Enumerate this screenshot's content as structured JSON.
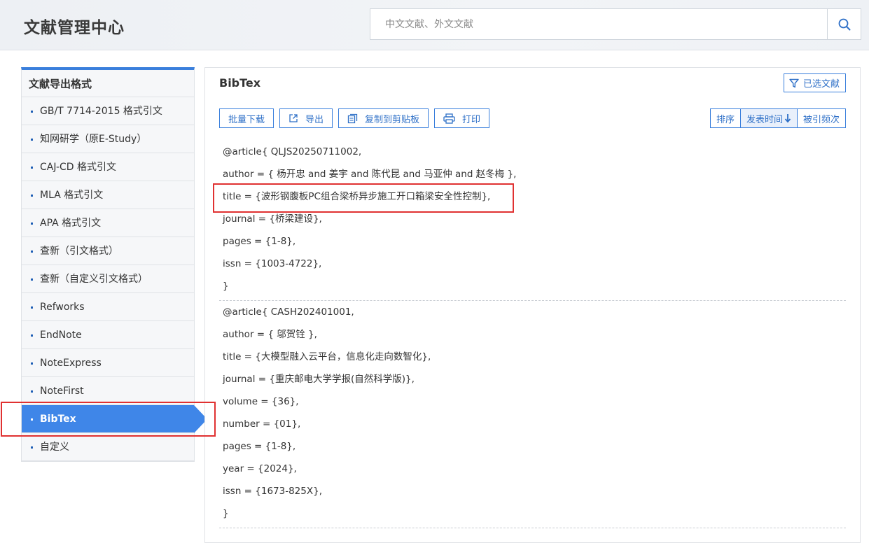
{
  "header": {
    "brand": "文献管理中心",
    "search_placeholder": "中文文献、外文文献"
  },
  "sidebar": {
    "title": "文献导出格式",
    "items": [
      {
        "label": "GB/T 7714-2015 格式引文"
      },
      {
        "label": "知网研学（原E-Study）"
      },
      {
        "label": "CAJ-CD 格式引文"
      },
      {
        "label": "MLA 格式引文"
      },
      {
        "label": "APA 格式引文"
      },
      {
        "label": "查新（引文格式）"
      },
      {
        "label": "查新（自定义引文格式）"
      },
      {
        "label": "Refworks"
      },
      {
        "label": "EndNote"
      },
      {
        "label": "NoteExpress"
      },
      {
        "label": "NoteFirst"
      },
      {
        "label": "BibTex",
        "active": true
      },
      {
        "label": "自定义"
      }
    ]
  },
  "main": {
    "title": "BibTex",
    "selected_label": "已选文献",
    "toolbar": {
      "batch_download": "批量下载",
      "export": "导出",
      "copy": "复制到剪贴板",
      "print": "打印"
    },
    "sort": {
      "label": "排序",
      "pub_time": "发表时间",
      "cited": "被引频次"
    },
    "entries": [
      {
        "lines": [
          "@article{ QLJS20250711002,",
          "author = { 杨开忠 and  姜宇 and  陈代昆 and  马亚仲 and  赵冬梅 },",
          "title = {波形钢腹板PC组合梁桥异步施工开口箱梁安全性控制},",
          "journal = {桥梁建设},",
          "pages = {1-8},",
          "issn = {1003-4722},",
          "}"
        ]
      },
      {
        "lines": [
          "@article{ CASH202401001,",
          "author = { 邬贺铨 },",
          "title = {大模型融入云平台，信息化走向数智化},",
          "journal = {重庆邮电大学学报(自然科学版)},",
          "volume = {36},",
          "number = {01},",
          "pages = {1-8},",
          "year = {2024},",
          "issn = {1673-825X},",
          "}"
        ]
      }
    ]
  },
  "colors": {
    "accent": "#3f86e8",
    "highlight": "#e03131"
  }
}
